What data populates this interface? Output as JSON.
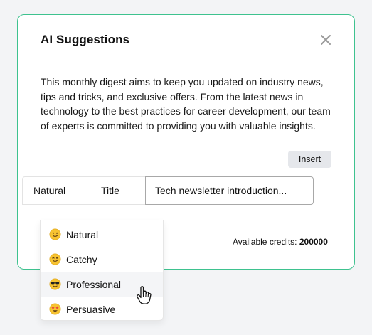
{
  "panel": {
    "title": "AI Suggestions",
    "body": "This monthly digest aims to keep you updated on industry news, tips and tricks, and exclusive offers. From the latest news in technology to the best practices for career development, our team of experts is committed to providing you with valuable insights.",
    "insert_label": "Insert",
    "close_icon": "close-icon"
  },
  "controls": {
    "tone_value": "Natural",
    "type_value": "Title",
    "prompt_value": "Tech newsletter introduction..."
  },
  "credits": {
    "label": "Available credits:",
    "value": "200000"
  },
  "tone_options": [
    {
      "label": "Natural",
      "icon": "slightly-smiling-face-icon",
      "hovered": false
    },
    {
      "label": "Catchy",
      "icon": "winking-face-icon",
      "hovered": false
    },
    {
      "label": "Professional",
      "icon": "sunglasses-face-icon",
      "hovered": true
    },
    {
      "label": "Persuasive",
      "icon": "star-struck-face-icon",
      "hovered": false
    }
  ],
  "colors": {
    "accent_border": "#3ec28f",
    "button_bg": "#e5e7eb",
    "hover_bg": "#f4f5f7",
    "emoji_yellow": "#f7c331"
  }
}
